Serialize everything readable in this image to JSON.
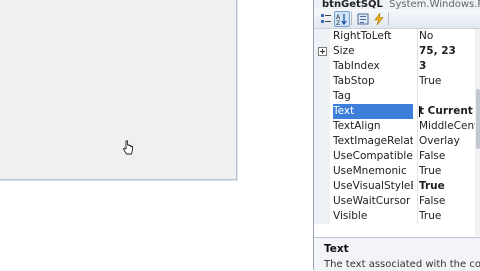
{
  "object_bar": {
    "name": "btnGetSQL",
    "type": "System.Windows.Fo"
  },
  "toolbar": {
    "buttons": [
      "categorized-icon",
      "alphabetical-icon",
      "properties-icon",
      "events-icon"
    ]
  },
  "properties": [
    {
      "name": "RightToLeft",
      "value": "No"
    },
    {
      "name": "Size",
      "value": "75, 23"
    },
    {
      "name": "TabIndex",
      "value": "3"
    },
    {
      "name": "TabStop",
      "value": "True"
    },
    {
      "name": "Tag",
      "value": ""
    },
    {
      "name": "Text",
      "value": "t Current SQ"
    },
    {
      "name": "TextAlign",
      "value": "MiddleCente"
    },
    {
      "name": "TextImageRelat",
      "value": "Overlay"
    },
    {
      "name": "UseCompatibleT",
      "value": "False"
    },
    {
      "name": "UseMnemonic",
      "value": "True"
    },
    {
      "name": "UseVisualStyleB",
      "value": "True"
    },
    {
      "name": "UseWaitCursor",
      "value": "False"
    },
    {
      "name": "Visible",
      "value": "True"
    }
  ],
  "description": {
    "title": "Text",
    "text": "The text associated with the co"
  },
  "colors": {
    "selection": "#3d7edb",
    "form_background": "#f0f0f0",
    "gutter": "#eef1f6"
  }
}
